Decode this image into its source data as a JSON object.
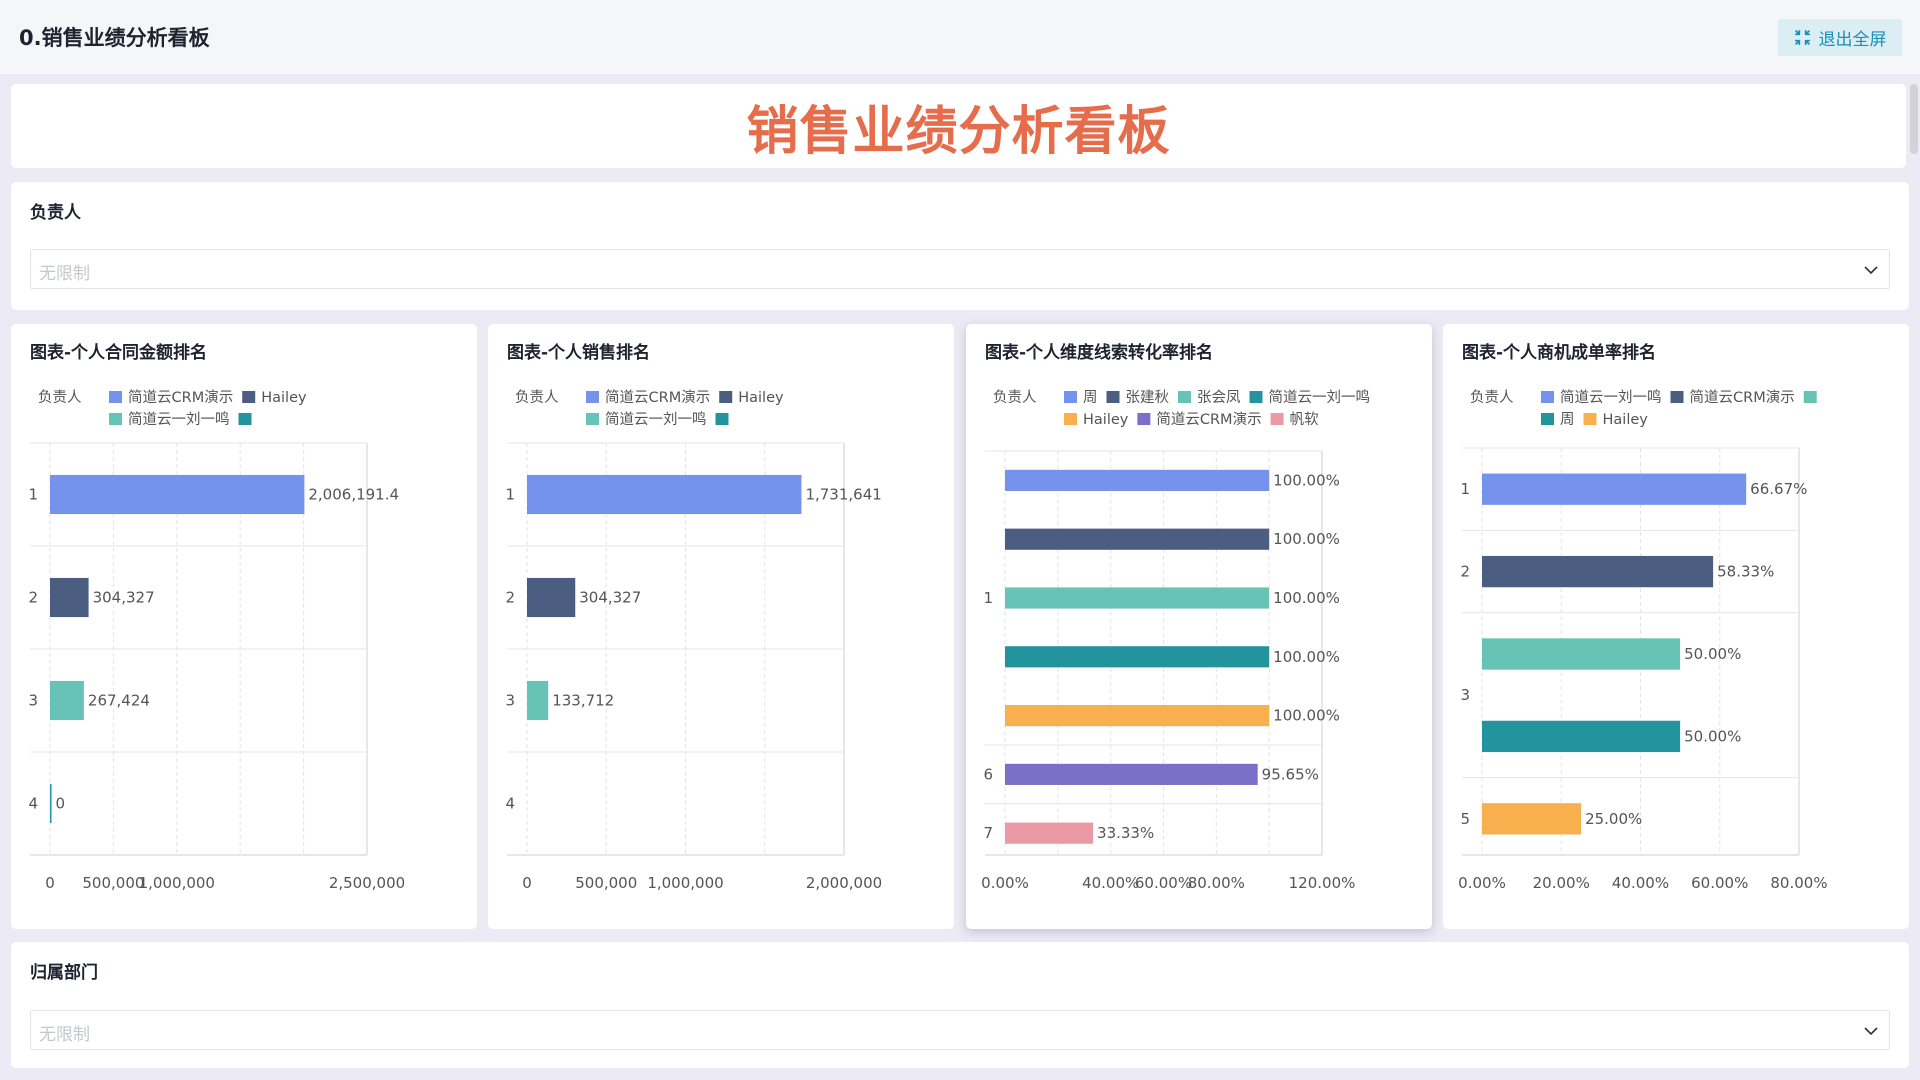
{
  "header": {
    "title": "0.销售业绩分析看板",
    "exit_label": "退出全屏"
  },
  "banner": {
    "title": "销售业绩分析看板"
  },
  "filters": [
    {
      "label": "负责人",
      "placeholder": "无限制"
    },
    {
      "label": "归属部门",
      "placeholder": "无限制"
    }
  ],
  "colors": {
    "series": [
      "#7592ec",
      "#4b5d80",
      "#66c3b6",
      "#23939d",
      "#f8b04f",
      "#7a70c9",
      "#ea9aa5"
    ],
    "accent": "#e56d4c",
    "exit": "#1a8fb8"
  },
  "chart_data": [
    {
      "type": "bar",
      "title": "图表-个人合同金额排名",
      "legend_title": "负责人",
      "legend": [
        {
          "name": "简道云CRM演示",
          "color": "#7592ec"
        },
        {
          "name": "Hailey",
          "color": "#4b5d80"
        },
        {
          "name": "简道云一刘一鸣",
          "color": "#66c3b6"
        },
        {
          "name": "",
          "color": "#23939d"
        }
      ],
      "categories": [
        "1",
        "2",
        "3",
        "4"
      ],
      "bars": [
        {
          "cat": "1",
          "value": 2006191.4,
          "label": "2,006,191.4",
          "color": "#7592ec"
        },
        {
          "cat": "2",
          "value": 304327,
          "label": "304,327",
          "color": "#4b5d80"
        },
        {
          "cat": "3",
          "value": 267424,
          "label": "267,424",
          "color": "#66c3b6"
        },
        {
          "cat": "4",
          "value": 0,
          "label": "0",
          "color": "#23939d"
        }
      ],
      "xlim": [
        0,
        2500000
      ],
      "xticks": [
        {
          "value": 0,
          "label": "0"
        },
        {
          "value": 500000,
          "label": "500,000"
        },
        {
          "value": 1000000,
          "label": "1,000,000"
        },
        {
          "value": 2500000,
          "label": "2,500,000"
        }
      ],
      "gridlines": [
        0,
        500000,
        1000000,
        1500000,
        2000000,
        2500000
      ]
    },
    {
      "type": "bar",
      "title": "图表-个人销售排名",
      "legend_title": "负责人",
      "legend": [
        {
          "name": "简道云CRM演示",
          "color": "#7592ec"
        },
        {
          "name": "Hailey",
          "color": "#4b5d80"
        },
        {
          "name": "简道云一刘一鸣",
          "color": "#66c3b6"
        },
        {
          "name": "",
          "color": "#23939d"
        }
      ],
      "categories": [
        "1",
        "2",
        "3",
        "4"
      ],
      "bars": [
        {
          "cat": "1",
          "value": 1731641,
          "label": "1,731,641",
          "color": "#7592ec"
        },
        {
          "cat": "2",
          "value": 304327,
          "label": "304,327",
          "color": "#4b5d80"
        },
        {
          "cat": "3",
          "value": 133712,
          "label": "133,712",
          "color": "#66c3b6"
        }
      ],
      "xlim": [
        0,
        2000000
      ],
      "xticks": [
        {
          "value": 0,
          "label": "0"
        },
        {
          "value": 500000,
          "label": "500,000"
        },
        {
          "value": 1000000,
          "label": "1,000,000"
        },
        {
          "value": 2000000,
          "label": "2,000,000"
        }
      ],
      "gridlines": [
        0,
        500000,
        1000000,
        1500000,
        2000000
      ]
    },
    {
      "type": "bar",
      "title": "图表-个人维度线索转化率排名",
      "legend_title": "负责人",
      "legend": [
        {
          "name": "周",
          "color": "#7592ec"
        },
        {
          "name": "张建秋",
          "color": "#4b5d80"
        },
        {
          "name": "张会凤",
          "color": "#66c3b6"
        },
        {
          "name": "简道云一刘一鸣",
          "color": "#23939d"
        },
        {
          "name": "Hailey",
          "color": "#f8b04f"
        },
        {
          "name": "简道云CRM演示",
          "color": "#7a70c9"
        },
        {
          "name": "帆软",
          "color": "#ea9aa5"
        }
      ],
      "categories": [
        "1",
        "6",
        "7"
      ],
      "bars": [
        {
          "cat": "1",
          "value": 100,
          "label": "100.00%",
          "color": "#7592ec"
        },
        {
          "cat": "1",
          "value": 100,
          "label": "100.00%",
          "color": "#4b5d80"
        },
        {
          "cat": "1",
          "value": 100,
          "label": "100.00%",
          "color": "#66c3b6"
        },
        {
          "cat": "1",
          "value": 100,
          "label": "100.00%",
          "color": "#23939d"
        },
        {
          "cat": "1",
          "value": 100,
          "label": "100.00%",
          "color": "#f8b04f"
        },
        {
          "cat": "6",
          "value": 95.65,
          "label": "95.65%",
          "color": "#7a70c9"
        },
        {
          "cat": "7",
          "value": 33.33,
          "label": "33.33%",
          "color": "#ea9aa5"
        }
      ],
      "xlim": [
        0,
        120
      ],
      "xticks": [
        {
          "value": 0,
          "label": "0.00%"
        },
        {
          "value": 40,
          "label": "40.00%"
        },
        {
          "value": 60,
          "label": "60.00%"
        },
        {
          "value": 80,
          "label": "80.00%"
        },
        {
          "value": 120,
          "label": "120.00%"
        }
      ],
      "gridlines": [
        0,
        20,
        40,
        60,
        80,
        100,
        120
      ]
    },
    {
      "type": "bar",
      "title": "图表-个人商机成单率排名",
      "legend_title": "负责人",
      "legend": [
        {
          "name": "简道云一刘一鸣",
          "color": "#7592ec"
        },
        {
          "name": "简道云CRM演示",
          "color": "#4b5d80"
        },
        {
          "name": "",
          "color": "#66c3b6"
        },
        {
          "name": "周",
          "color": "#23939d"
        },
        {
          "name": "Hailey",
          "color": "#f8b04f"
        }
      ],
      "categories": [
        "1",
        "2",
        "3",
        "5"
      ],
      "bars": [
        {
          "cat": "1",
          "value": 66.67,
          "label": "66.67%",
          "color": "#7592ec"
        },
        {
          "cat": "2",
          "value": 58.33,
          "label": "58.33%",
          "color": "#4b5d80"
        },
        {
          "cat": "3",
          "value": 50,
          "label": "50.00%",
          "color": "#66c3b6"
        },
        {
          "cat": "3",
          "value": 50,
          "label": "50.00%",
          "color": "#23939d"
        },
        {
          "cat": "5",
          "value": 25,
          "label": "25.00%",
          "color": "#f8b04f"
        }
      ],
      "xlim": [
        0,
        80
      ],
      "xticks": [
        {
          "value": 0,
          "label": "0.00%"
        },
        {
          "value": 20,
          "label": "20.00%"
        },
        {
          "value": 40,
          "label": "40.00%"
        },
        {
          "value": 60,
          "label": "60.00%"
        },
        {
          "value": 80,
          "label": "80.00%"
        }
      ],
      "gridlines": [
        0,
        20,
        40,
        60,
        80
      ]
    }
  ]
}
